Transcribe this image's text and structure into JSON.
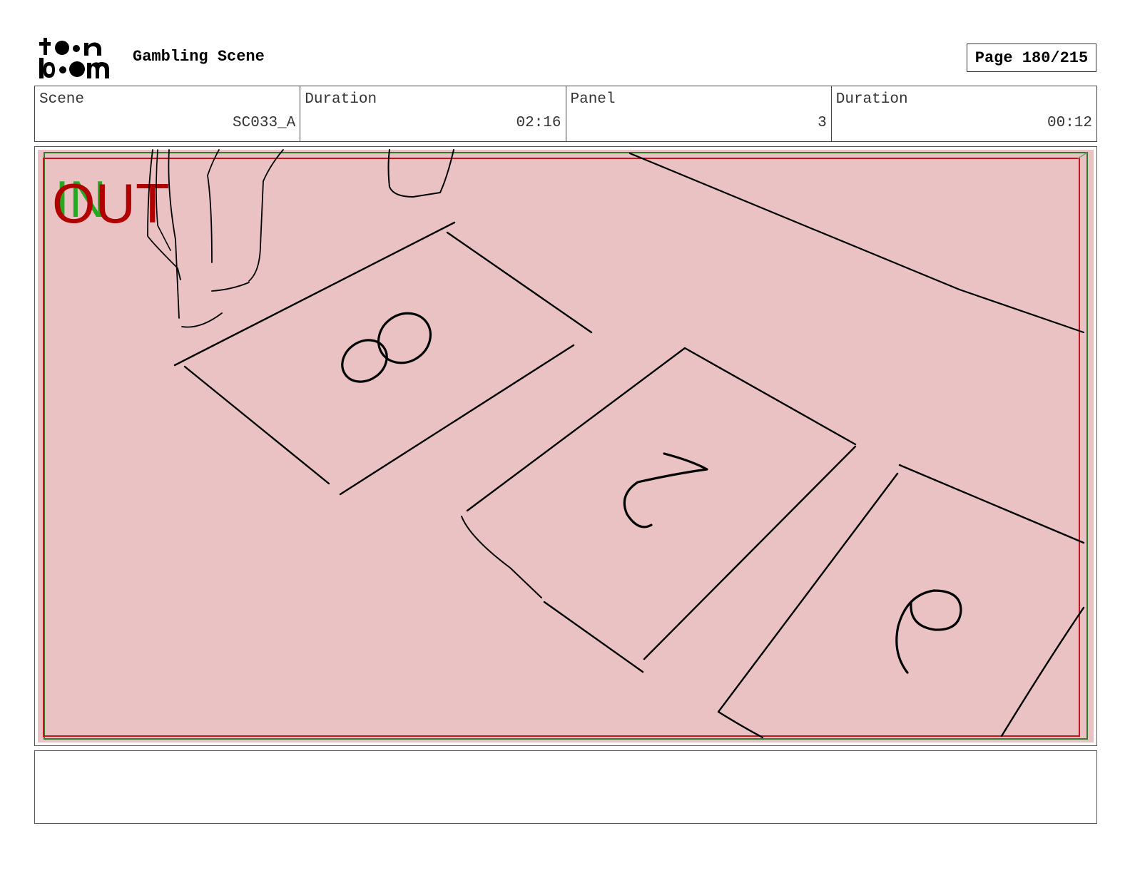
{
  "header": {
    "logo_text": "toon boom",
    "scene_title": "Gambling Scene",
    "page_label": "Page 180/215"
  },
  "info": {
    "scene_label": "Scene",
    "scene_value": "SC033_A",
    "scene_duration_label": "Duration",
    "scene_duration_value": "02:16",
    "panel_label": "Panel",
    "panel_value": "3",
    "panel_duration_label": "Duration",
    "panel_duration_value": "00:12"
  },
  "panel": {
    "in_marker": "IN",
    "out_marker": "OUT",
    "card_numbers": [
      "8",
      "7",
      "6"
    ],
    "colors": {
      "tint": "#ebc2c4",
      "in_color": "#22aa22",
      "out_color": "#b00000",
      "ink": "#000000"
    }
  },
  "notes": {
    "text": ""
  }
}
